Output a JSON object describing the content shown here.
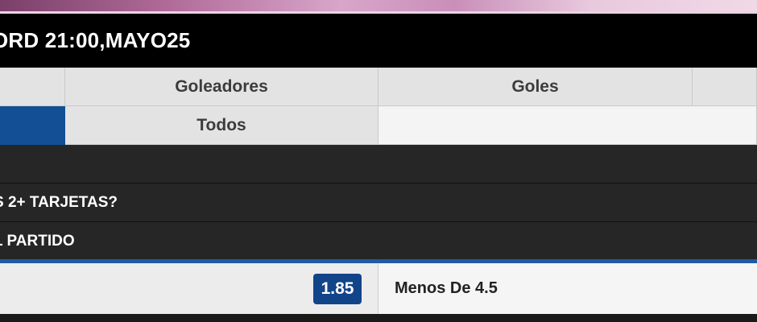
{
  "header": {
    "match_title": "ORD 21:00,MAYO25"
  },
  "tabs_row1": {
    "items": [
      {
        "label": ""
      },
      {
        "label": "Goleadores"
      },
      {
        "label": "Goles"
      },
      {
        "label": ""
      }
    ]
  },
  "tabs_row2": {
    "items": [
      {
        "label": ""
      },
      {
        "label": "Todos"
      },
      {
        "label": ""
      }
    ]
  },
  "sections": [
    {
      "label": ""
    },
    {
      "label": "S 2+ TARJETAS?"
    },
    {
      "label": "L PARTIDO"
    }
  ],
  "odds": {
    "left_value": "1.85",
    "right_label": "Menos De 4.5"
  },
  "colors": {
    "active_tab": "#124f94",
    "odds_badge": "#12448a",
    "header_bg": "#000000",
    "section_bg": "#262626"
  }
}
